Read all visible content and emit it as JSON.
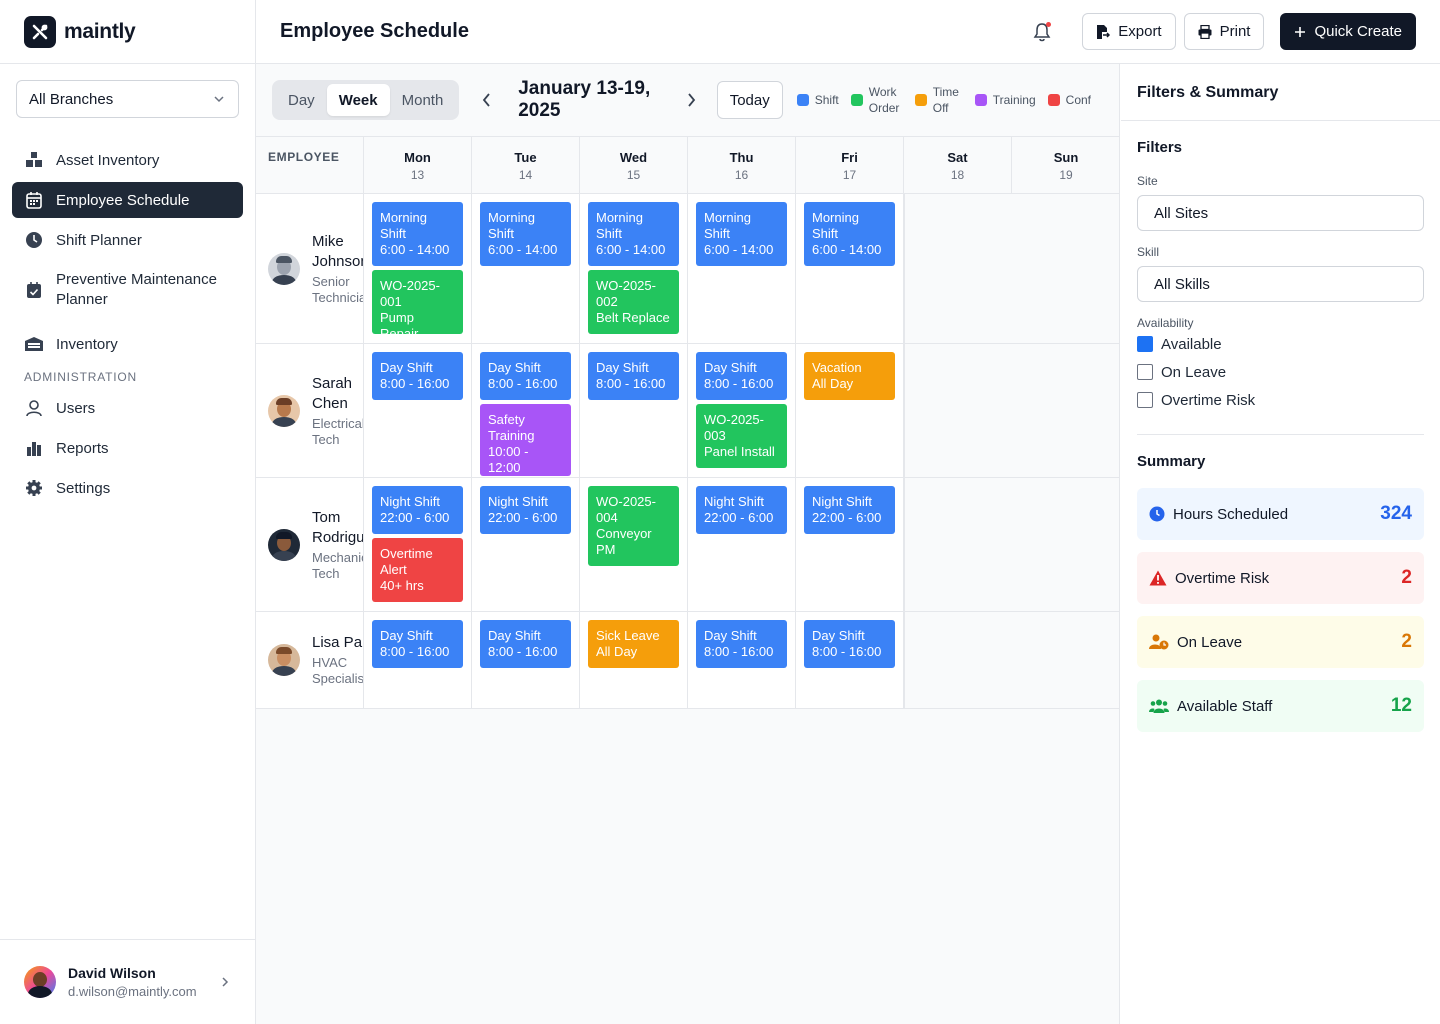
{
  "brand": {
    "name": "maintly"
  },
  "branch_select": {
    "value": "All Branches"
  },
  "nav": {
    "items": [
      {
        "label": "Asset Inventory",
        "icon": "boxes-icon"
      },
      {
        "label": "Employee Schedule",
        "icon": "calendar-icon",
        "active": true
      },
      {
        "label": "Shift Planner",
        "icon": "clock-icon"
      },
      {
        "label": "Preventive Maintenance Planner",
        "icon": "calendar-check-icon"
      },
      {
        "label": "Inventory",
        "icon": "warehouse-icon"
      }
    ],
    "admin_section": "ADMINISTRATION",
    "admin_items": [
      {
        "label": "Users",
        "icon": "user-icon"
      },
      {
        "label": "Reports",
        "icon": "bar-chart-icon"
      },
      {
        "label": "Settings",
        "icon": "gear-icon"
      }
    ]
  },
  "user": {
    "name": "David Wilson",
    "email": "d.wilson@maintly.com"
  },
  "header": {
    "title": "Employee Schedule",
    "export_label": "Export",
    "print_label": "Print",
    "quick_create_label": "Quick Create"
  },
  "toolbar": {
    "views": [
      "Day",
      "Week",
      "Month"
    ],
    "active_view": "Week",
    "range": "January 13-19, 2025",
    "today_label": "Today",
    "legend": [
      {
        "label": "Shift",
        "color": "#3b82f6"
      },
      {
        "label": "Work Order",
        "color": "#22c55e"
      },
      {
        "label": "Time Off",
        "color": "#f59e0b"
      },
      {
        "label": "Training",
        "color": "#a855f7"
      },
      {
        "label": "Conf",
        "color": "#ef4444"
      }
    ]
  },
  "grid": {
    "employee_header": "EMPLOYEE",
    "days": [
      {
        "name": "Mon",
        "num": "13"
      },
      {
        "name": "Tue",
        "num": "14"
      },
      {
        "name": "Wed",
        "num": "15"
      },
      {
        "name": "Thu",
        "num": "16"
      },
      {
        "name": "Fri",
        "num": "17"
      },
      {
        "name": "Sat",
        "num": "18"
      },
      {
        "name": "Sun",
        "num": "19"
      }
    ],
    "employees": [
      {
        "name": "Mike Johnson",
        "role": "Senior Technician",
        "days": [
          [
            {
              "type": "shift",
              "lines": [
                "Morning Shift",
                "6:00 - 14:00"
              ]
            },
            {
              "type": "wo",
              "lines": [
                "WO-2025-001",
                "Pump Repair"
              ]
            }
          ],
          [
            {
              "type": "shift",
              "lines": [
                "Morning Shift",
                "6:00 - 14:00"
              ]
            }
          ],
          [
            {
              "type": "shift",
              "lines": [
                "Morning Shift",
                "6:00 - 14:00"
              ]
            },
            {
              "type": "wo",
              "lines": [
                "WO-2025-002",
                "Belt Replace"
              ]
            }
          ],
          [
            {
              "type": "shift",
              "lines": [
                "Morning Shift",
                "6:00 - 14:00"
              ]
            }
          ],
          [
            {
              "type": "shift",
              "lines": [
                "Morning Shift",
                "6:00 - 14:00"
              ]
            }
          ],
          [],
          []
        ]
      },
      {
        "name": "Sarah Chen",
        "role": "Electrical Tech",
        "days": [
          [
            {
              "type": "shift",
              "lines": [
                "Day Shift",
                "8:00 - 16:00"
              ]
            }
          ],
          [
            {
              "type": "shift",
              "lines": [
                "Day Shift",
                "8:00 - 16:00"
              ]
            },
            {
              "type": "train",
              "lines": [
                "Safety Training",
                "10:00 - 12:00"
              ]
            }
          ],
          [
            {
              "type": "shift",
              "lines": [
                "Day Shift",
                "8:00 - 16:00"
              ]
            }
          ],
          [
            {
              "type": "shift",
              "lines": [
                "Day Shift",
                "8:00 - 16:00"
              ]
            },
            {
              "type": "wo",
              "lines": [
                "WO-2025-003",
                "Panel Install"
              ]
            }
          ],
          [
            {
              "type": "off",
              "lines": [
                "Vacation",
                "All Day"
              ]
            }
          ],
          [],
          []
        ]
      },
      {
        "name": "Tom Rodriguez",
        "role": "Mechanical Tech",
        "days": [
          [
            {
              "type": "shift",
              "lines": [
                "Night Shift",
                "22:00 - 6:00"
              ]
            },
            {
              "type": "alert",
              "lines": [
                "Overtime Alert",
                "40+ hrs"
              ]
            }
          ],
          [
            {
              "type": "shift",
              "lines": [
                "Night Shift",
                "22:00 - 6:00"
              ]
            }
          ],
          [
            {
              "type": "wo",
              "lines": [
                "WO-2025-004",
                "Conveyor PM"
              ]
            }
          ],
          [
            {
              "type": "shift",
              "lines": [
                "Night Shift",
                "22:00 - 6:00"
              ]
            }
          ],
          [
            {
              "type": "shift",
              "lines": [
                "Night Shift",
                "22:00 - 6:00"
              ]
            }
          ],
          [],
          []
        ]
      },
      {
        "name": "Lisa Park",
        "role": "HVAC Specialist",
        "days": [
          [
            {
              "type": "shift",
              "lines": [
                "Day Shift",
                "8:00 - 16:00"
              ]
            }
          ],
          [
            {
              "type": "shift",
              "lines": [
                "Day Shift",
                "8:00 - 16:00"
              ]
            }
          ],
          [
            {
              "type": "off",
              "lines": [
                "Sick Leave",
                "All Day"
              ]
            }
          ],
          [
            {
              "type": "shift",
              "lines": [
                "Day Shift",
                "8:00 - 16:00"
              ]
            }
          ],
          [
            {
              "type": "shift",
              "lines": [
                "Day Shift",
                "8:00 - 16:00"
              ]
            }
          ],
          [],
          []
        ]
      }
    ]
  },
  "panel": {
    "title": "Filters & Summary",
    "filters_title": "Filters",
    "site_label": "Site",
    "site_value": "All Sites",
    "skill_label": "Skill",
    "skill_value": "All Skills",
    "availability_label": "Availability",
    "availability": [
      {
        "label": "Available",
        "checked": true
      },
      {
        "label": "On Leave",
        "checked": false
      },
      {
        "label": "Overtime Risk",
        "checked": false
      }
    ],
    "summary_title": "Summary",
    "summary": [
      {
        "label": "Hours Scheduled",
        "value": "324",
        "icon": "clock-icon",
        "bg": "#eff6ff",
        "color": "#2563eb"
      },
      {
        "label": "Overtime Risk",
        "value": "2",
        "icon": "warning-icon",
        "bg": "#fef2f2",
        "color": "#dc2626"
      },
      {
        "label": "On Leave",
        "value": "2",
        "icon": "user-clock-icon",
        "bg": "#fefce8",
        "color": "#d97706"
      },
      {
        "label": "Available Staff",
        "value": "12",
        "icon": "users-icon",
        "bg": "#f0fdf4",
        "color": "#16a34a"
      }
    ]
  }
}
